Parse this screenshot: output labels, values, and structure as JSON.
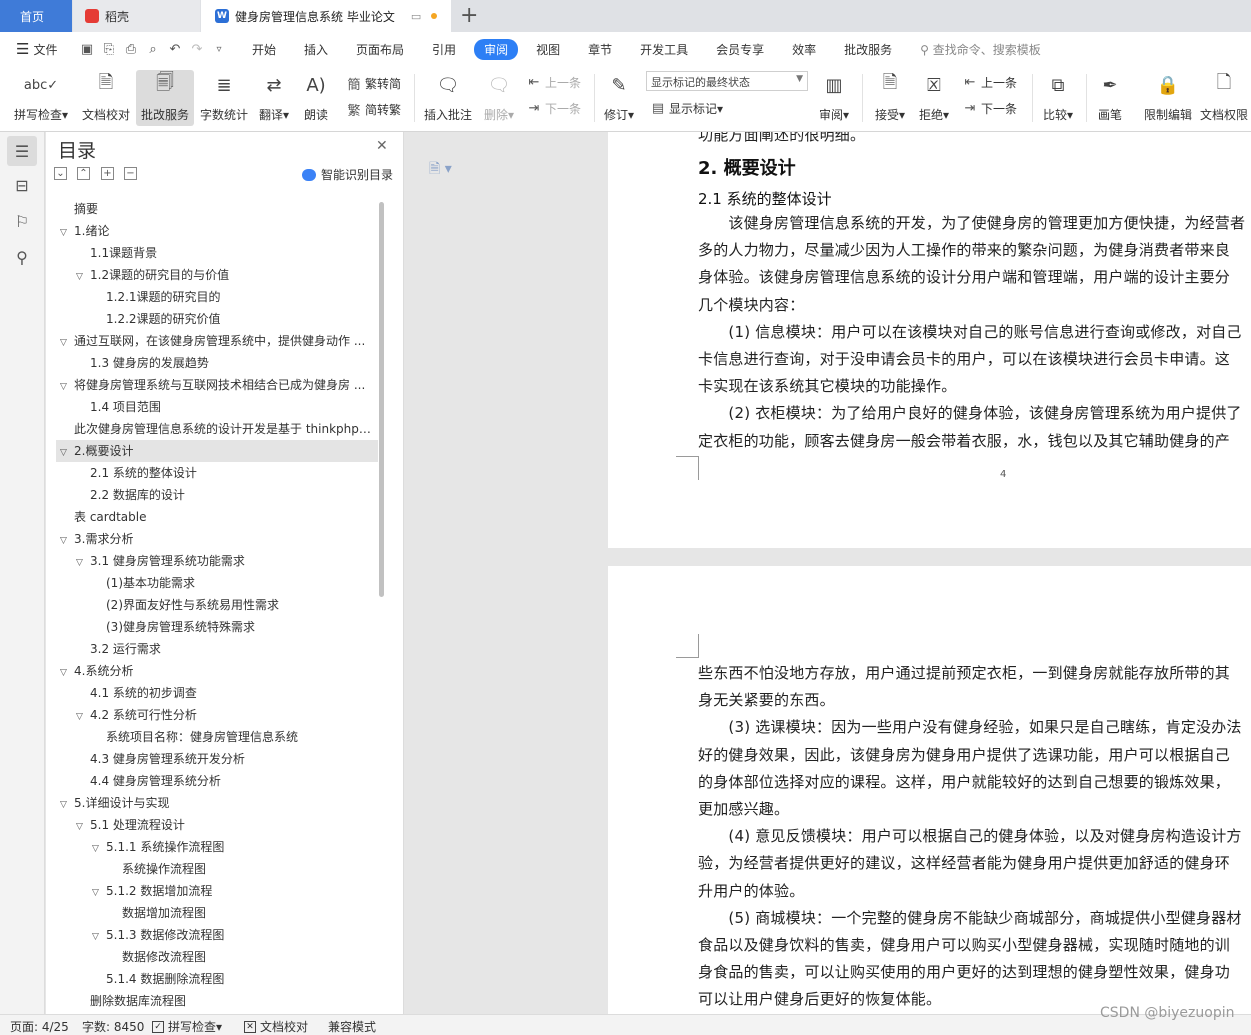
{
  "tabs": {
    "home": "首页",
    "daoke": "稻壳",
    "doc": "健身房管理信息系统 毕业论文",
    "doc_icon": "W"
  },
  "menubar": {
    "file": "文件",
    "items": [
      "开始",
      "插入",
      "页面布局",
      "引用",
      "审阅",
      "视图",
      "章节",
      "开发工具",
      "会员专享",
      "效率",
      "批改服务"
    ],
    "active": "审阅",
    "search": "查找命令、搜索模板"
  },
  "ribbon": {
    "spellcheck": "拼写检查",
    "doc_proof": "文档校对",
    "correction": "批改服务",
    "word_count": "字数统计",
    "translate": "翻译",
    "read_aloud": "朗读",
    "trad_to_simp": "繁转简",
    "simp_to_trad": "简转繁",
    "insert_comment": "插入批注",
    "delete": "删除",
    "prev": "上一条",
    "next": "下一条",
    "track_changes": "修订",
    "mark_state": "显示标记的最终状态",
    "show_marks": "显示标记",
    "review": "审阅",
    "accept": "接受",
    "reject": "拒绝",
    "prev2": "上一条",
    "next2": "下一条",
    "compare": "比较",
    "pen": "画笔",
    "restrict_edit": "限制编辑",
    "doc_permission": "文档权限"
  },
  "toc": {
    "title": "目录",
    "smart": "智能识别目录",
    "items": [
      {
        "text": "摘要",
        "level": 0,
        "chev": false
      },
      {
        "text": "1.绪论",
        "level": 0,
        "chev": true
      },
      {
        "text": "1.1课题背景",
        "level": 1,
        "chev": false
      },
      {
        "text": "1.2课题的研究目的与价值",
        "level": 1,
        "chev": true
      },
      {
        "text": "1.2.1课题的研究目的",
        "level": 2,
        "chev": false
      },
      {
        "text": "1.2.2课题的研究价值",
        "level": 2,
        "chev": false
      },
      {
        "text": "通过互联网，在该健身房管理系统中，提供健身动作 ...",
        "level": 0,
        "chev": true
      },
      {
        "text": "1.3  健身房的发展趋势",
        "level": 1,
        "chev": false
      },
      {
        "text": "将健身房管理系统与互联网技术相结合已成为健身房 ...",
        "level": 0,
        "chev": true
      },
      {
        "text": "1.4 项目范围",
        "level": 1,
        "chev": false
      },
      {
        "text": "此次健身房管理信息系统的设计开发是基于 thinkphp5 ...",
        "level": 0,
        "chev": false
      },
      {
        "text": "2.概要设计",
        "level": 0,
        "chev": true,
        "selected": true
      },
      {
        "text": "2.1  系统的整体设计",
        "level": 1,
        "chev": false
      },
      {
        "text": "2.2  数据库的设计",
        "level": 1,
        "chev": false
      },
      {
        "text": "表 cardtable",
        "level": 0,
        "chev": false
      },
      {
        "text": "3.需求分析",
        "level": 0,
        "chev": true
      },
      {
        "text": "3.1  健身房管理系统功能需求",
        "level": 1,
        "chev": true
      },
      {
        "text": "(1)基本功能需求",
        "level": 2,
        "chev": false
      },
      {
        "text": "(2)界面友好性与系统易用性需求",
        "level": 2,
        "chev": false
      },
      {
        "text": "(3)健身房管理系统特殊需求",
        "level": 2,
        "chev": false
      },
      {
        "text": "3.2  运行需求",
        "level": 1,
        "chev": false
      },
      {
        "text": "4.系统分析",
        "level": 0,
        "chev": true
      },
      {
        "text": "4.1  系统的初步调查",
        "level": 1,
        "chev": false
      },
      {
        "text": "4.2  系统可行性分析",
        "level": 1,
        "chev": true
      },
      {
        "text": "系统项目名称：健身房管理信息系统",
        "level": 2,
        "chev": false
      },
      {
        "text": "4.3  健身房管理系统开发分析",
        "level": 1,
        "chev": false
      },
      {
        "text": "4.4 健身房管理系统分析",
        "level": 1,
        "chev": false
      },
      {
        "text": "5.详细设计与实现",
        "level": 0,
        "chev": true
      },
      {
        "text": "5.1  处理流程设计",
        "level": 1,
        "chev": true
      },
      {
        "text": "5.1.1  系统操作流程图",
        "level": 2,
        "chev": true
      },
      {
        "text": "系统操作流程图",
        "level": 3,
        "chev": false
      },
      {
        "text": "5.1.2  数据增加流程",
        "level": 2,
        "chev": true
      },
      {
        "text": "数据增加流程图",
        "level": 3,
        "chev": false
      },
      {
        "text": "5.1.3  数据修改流程图",
        "level": 2,
        "chev": true
      },
      {
        "text": "数据修改流程图",
        "level": 3,
        "chev": false
      },
      {
        "text": "5.1.4  数据删除流程图",
        "level": 2,
        "chev": false
      },
      {
        "text": "删除数据库流程图",
        "level": 1,
        "chev": false
      }
    ]
  },
  "page1": {
    "top_cut": "功能方面阐述的很明细。",
    "h2": "2. 概要设计",
    "h3": "2.1  系统的整体设计",
    "lines": [
      "　　该健身房管理信息系统的开发，为了使健身房的管理更加方便快捷，为经营者",
      "多的人力物力，尽量减少因为人工操作的带来的繁杂问题，为健身消费者带来良",
      "身体验。该健身房管理信息系统的设计分用户端和管理端，用户端的设计主要分",
      "几个模块内容：",
      "　　(1) 信息模块：用户可以在该模块对自己的账号信息进行查询或修改，对自己",
      "卡信息进行查询，对于没申请会员卡的用户，可以在该模块进行会员卡申请。这",
      "卡实现在该系统其它模块的功能操作。",
      "　　(2) 衣柜模块：为了给用户良好的健身体验，该健身房管理系统为用户提供了",
      "定衣柜的功能，顾客去健身房一般会带着衣服，水，钱包以及其它辅助健身的产"
    ],
    "page_number": "4"
  },
  "page2": {
    "lines": [
      "些东西不怕没地方存放，用户通过提前预定衣柜，一到健身房就能存放所带的其",
      "身无关紧要的东西。",
      "　　(3) 选课模块：因为一些用户没有健身经验，如果只是自己瞎练，肯定没办法",
      "好的健身效果，因此，该健身房为健身用户提供了选课功能，用户可以根据自己",
      "的身体部位选择对应的课程。这样，用户就能较好的达到自己想要的锻炼效果，",
      "更加感兴趣。",
      "　　(4) 意见反馈模块：用户可以根据自己的健身体验，以及对健身房构造设计方",
      "验，为经营者提供更好的建议，这样经营者能为健身用户提供更加舒适的健身环",
      "升用户的体验。",
      "　　(5) 商城模块：一个完整的健身房不能缺少商城部分，商城提供小型健身器材",
      "食品以及健身饮料的售卖，健身用户可以购买小型健身器械，实现随时随地的训",
      "身食品的售卖，可以让购买使用的用户更好的达到理想的健身塑性效果，健身功",
      "可以让用户健身后更好的恢复体能。"
    ]
  },
  "status": {
    "page": "页面: 4/25",
    "words": "字数: 8450",
    "spellcheck": "拼写检查",
    "proof": "文档校对",
    "compat": "兼容模式"
  },
  "watermark": "CSDN @biyezuopin"
}
